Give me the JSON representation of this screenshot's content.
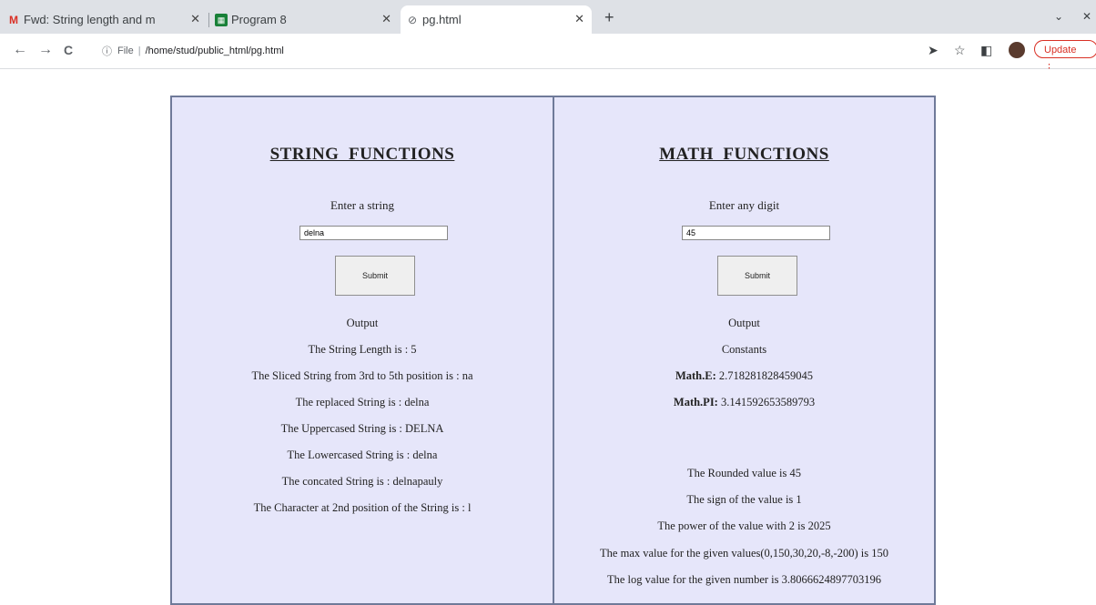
{
  "browser": {
    "tabs": [
      {
        "icon": "gmail-icon",
        "label": "Fwd: String length and m"
      },
      {
        "icon": "sheets-icon",
        "label": "Program 8"
      },
      {
        "icon": "globe-icon",
        "label": "pg.html"
      }
    ],
    "new_tab": "+",
    "address": {
      "scheme": "File",
      "path": "/home/stud/public_html/pg.html"
    },
    "update_label": "Update"
  },
  "left": {
    "title": "STRING  FUNCTIONS",
    "prompt": "Enter a string",
    "input_value": "delna",
    "submit_label": "Submit",
    "output_label": "Output",
    "results": [
      "The String Length is : 5",
      "The Sliced String from 3rd to 5th position is : na",
      "The replaced String is : delna",
      "The Uppercased String is : DELNA",
      "The Lowercased String is : delna",
      "The concated String is : delnapauly",
      "The Character at 2nd position of the String is : l"
    ]
  },
  "right": {
    "title": "MATH  FUNCTIONS",
    "prompt": "Enter any digit",
    "input_value": "45",
    "submit_label": "Submit",
    "output_label": "Output",
    "constants_label": "Constants",
    "math_e_label": "Math.E:",
    "math_e_value": "2.718281828459045",
    "math_pi_label": "Math.PI:",
    "math_pi_value": "3.141592653589793",
    "results": [
      "The Rounded value is 45",
      "The sign of the value is 1",
      "The power of the value with 2 is 2025",
      "The max value for the given values(0,150,30,20,-8,-200) is 150",
      "The log value for the given number is 3.8066624897703196"
    ]
  },
  "colors": {
    "panel_bg": "#e6e6fa",
    "panel_border": "#6f7a99",
    "update_red": "#d93025"
  }
}
